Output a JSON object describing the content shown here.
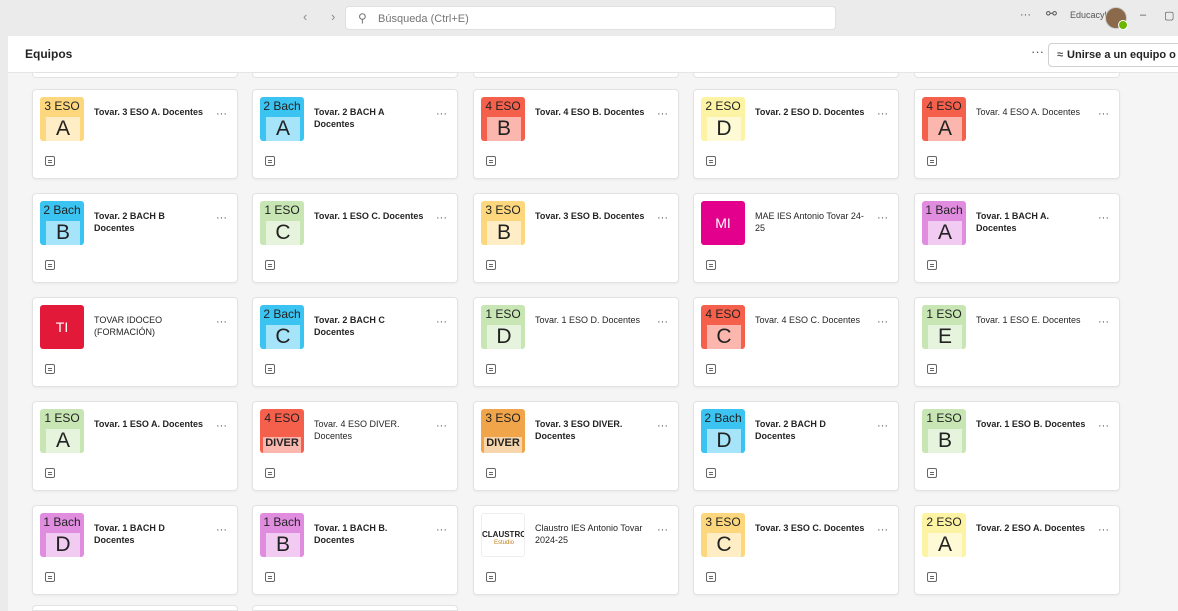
{
  "titlebar": {
    "nav_arrows": "‹ ›",
    "search_placeholder": "Búsqueda (Ctrl+E)",
    "more": "···",
    "org_name": "Educacyl",
    "minimize": "–",
    "restore": "▢"
  },
  "header": {
    "title": "Equipos",
    "more": "···",
    "join_label": "Unirse a un equipo o crear uno"
  },
  "colors": {
    "yellow": "#fcd77e",
    "blue": "#3bc3f2",
    "red": "#f5604d",
    "lightyellow": "#fdf3a4",
    "green": "#c7e6b4",
    "pink": "#e08de0",
    "magenta": "#e3008c",
    "crimson": "#e3193a",
    "orange": "#f0a54a"
  },
  "teams": [
    {
      "tile_top": "3 ESO",
      "tile_letter": "A",
      "tile_color": "#fcd77e",
      "name": "Tovar. 3 ESO A. Docentes",
      "bold": true
    },
    {
      "tile_top": "2 Bach",
      "tile_letter": "A",
      "tile_color": "#3bc3f2",
      "name": "Tovar. 2 BACH A Docentes",
      "bold": true
    },
    {
      "tile_top": "4 ESO",
      "tile_letter": "B",
      "tile_color": "#f5604d",
      "name": "Tovar. 4 ESO B. Docentes",
      "bold": true
    },
    {
      "tile_top": "2 ESO",
      "tile_letter": "D",
      "tile_color": "#fdf3a4",
      "name": "Tovar. 2 ESO D. Docentes",
      "bold": true
    },
    {
      "tile_top": "4 ESO",
      "tile_letter": "A",
      "tile_color": "#f5604d",
      "name": "Tovar. 4 ESO A. Docentes",
      "bold": false
    },
    {
      "tile_top": "2 Bach",
      "tile_letter": "B",
      "tile_color": "#3bc3f2",
      "name": "Tovar. 2 BACH B Docentes",
      "bold": true
    },
    {
      "tile_top": "1 ESO",
      "tile_letter": "C",
      "tile_color": "#c7e6b4",
      "name": "Tovar. 1 ESO C. Docentes",
      "bold": true
    },
    {
      "tile_top": "3 ESO",
      "tile_letter": "B",
      "tile_color": "#fcd77e",
      "name": "Tovar. 3 ESO B. Docentes",
      "bold": true
    },
    {
      "tile_initials": "MI",
      "tile_color": "#e3008c",
      "name": "MAE IES Antonio Tovar 24-25",
      "bold": false
    },
    {
      "tile_top": "1 Bach",
      "tile_letter": "A",
      "tile_color": "#e08de0",
      "name": "Tovar. 1 BACH A. Docentes",
      "bold": true
    },
    {
      "tile_initials": "TI",
      "tile_color": "#e3193a",
      "name": "TOVAR IDOCEO (FORMACIÓN)",
      "bold": false
    },
    {
      "tile_top": "2 Bach",
      "tile_letter": "C",
      "tile_color": "#3bc3f2",
      "name": "Tovar. 2 BACH C Docentes",
      "bold": true
    },
    {
      "tile_top": "1 ESO",
      "tile_letter": "D",
      "tile_color": "#c7e6b4",
      "name": "Tovar. 1 ESO D. Docentes",
      "bold": false
    },
    {
      "tile_top": "4 ESO",
      "tile_letter": "C",
      "tile_color": "#f5604d",
      "name": "Tovar. 4 ESO C. Docentes",
      "bold": false
    },
    {
      "tile_top": "1 ESO",
      "tile_letter": "E",
      "tile_color": "#c7e6b4",
      "name": "Tovar. 1 ESO E. Docentes",
      "bold": false
    },
    {
      "tile_top": "1 ESO",
      "tile_letter": "A",
      "tile_color": "#c7e6b4",
      "name": "Tovar. 1 ESO A. Docentes",
      "bold": true
    },
    {
      "tile_top": "4 ESO",
      "tile_letter": "DIVER",
      "tile_color": "#f5604d",
      "name": "Tovar. 4 ESO DIVER. Docentes",
      "bold": false
    },
    {
      "tile_top": "3 ESO",
      "tile_letter": "DIVER",
      "tile_color": "#f0a54a",
      "name": "Tovar. 3 ESO DIVER. Docentes",
      "bold": true
    },
    {
      "tile_top": "2 Bach",
      "tile_letter": "D",
      "tile_color": "#3bc3f2",
      "name": "Tovar. 2 BACH D Docentes",
      "bold": true
    },
    {
      "tile_top": "1 ESO",
      "tile_letter": "B",
      "tile_color": "#c7e6b4",
      "name": "Tovar. 1 ESO B. Docentes",
      "bold": true
    },
    {
      "tile_top": "1 Bach",
      "tile_letter": "D",
      "tile_color": "#e08de0",
      "name": "Tovar. 1 BACH D Docentes",
      "bold": true
    },
    {
      "tile_top": "1 Bach",
      "tile_letter": "B",
      "tile_color": "#e08de0",
      "name": "Tovar. 1 BACH B. Docentes",
      "bold": true
    },
    {
      "tile_claustro": "CLAUSTRO",
      "tile_claustro_sub": "Estudio",
      "tile_color": "#ffffff",
      "name": "Claustro IES Antonio Tovar 2024-25",
      "bold": false
    },
    {
      "tile_top": "3 ESO",
      "tile_letter": "C",
      "tile_color": "#fcd77e",
      "name": "Tovar. 3 ESO C. Docentes",
      "bold": true
    },
    {
      "tile_top": "2 ESO",
      "tile_letter": "A",
      "tile_color": "#fdf3a4",
      "name": "Tovar. 2 ESO A. Docentes",
      "bold": true
    }
  ],
  "card_more": "···"
}
